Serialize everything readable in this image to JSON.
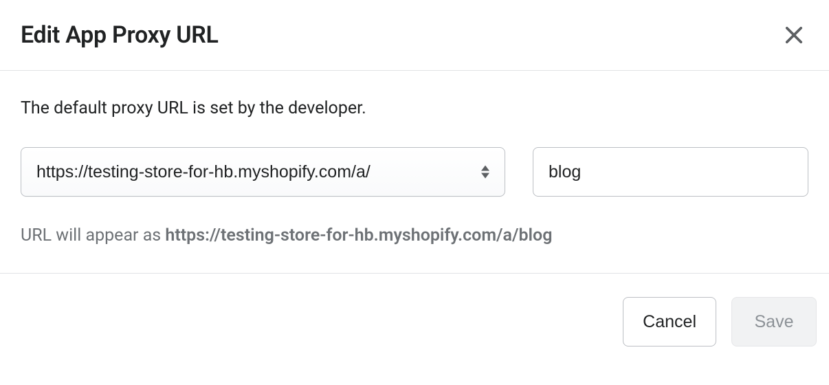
{
  "dialog": {
    "title": "Edit App Proxy URL",
    "description": "The default proxy URL is set by the developer.",
    "select_value": "https://testing-store-for-hb.myshopify.com/a/",
    "path_value": "blog",
    "hint_prefix": "URL will appear as ",
    "hint_url": "https://testing-store-for-hb.myshopify.com/a/blog",
    "cancel_label": "Cancel",
    "save_label": "Save"
  }
}
